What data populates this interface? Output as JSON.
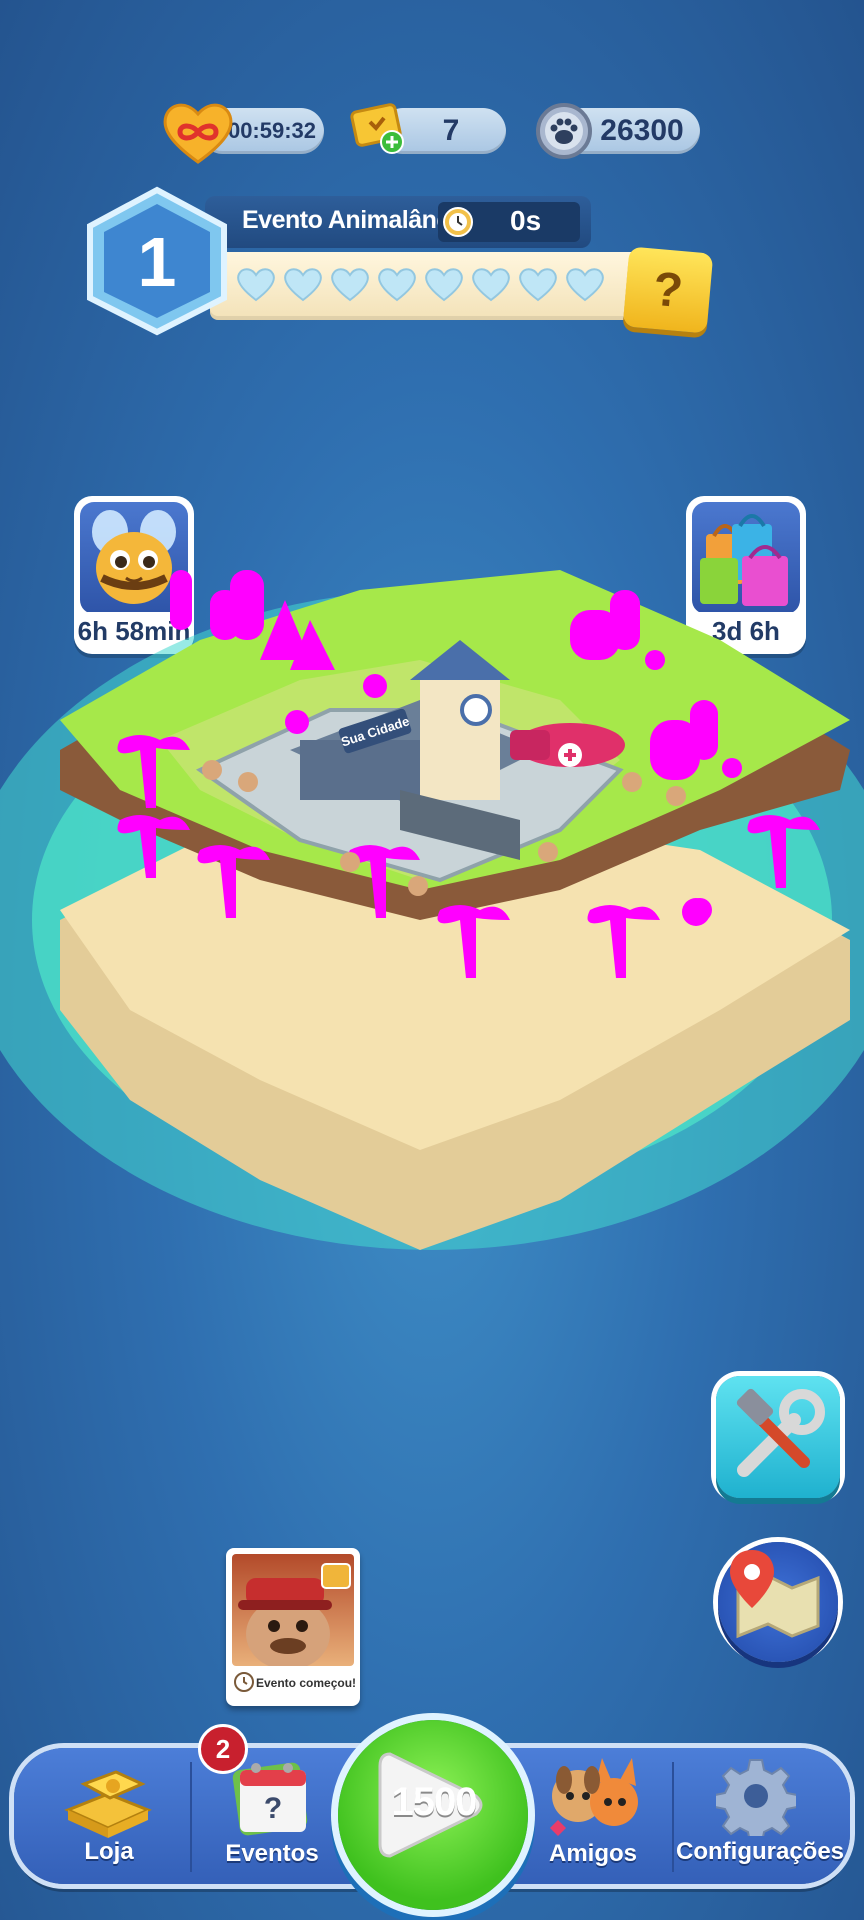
{
  "topbar": {
    "lives_timer": "00:59:32",
    "tickets": "7",
    "paws": "26300"
  },
  "event": {
    "level": "1",
    "title": "Evento Animalândia",
    "timer": "0s",
    "hearts_total": 8,
    "mystery": "?"
  },
  "side_events": {
    "left_timer": "6h 58min",
    "right_timer": "3d 6h"
  },
  "island": {
    "station_sign": "Sua Cidade"
  },
  "event_card": {
    "caption": "Evento começou!"
  },
  "nav": {
    "shop": "Loja",
    "events": "Eventos",
    "events_badge": "2",
    "play": "1500",
    "friends": "Amigos",
    "settings": "Configurações"
  },
  "colors": {
    "water": "#3ee0c8",
    "grass": "#a6e84a",
    "sand": "#f5e2b0",
    "magenta_trees": "#ff00ff",
    "play_green": "#4fcb25"
  },
  "icons": [
    "infinity-heart-icon",
    "ticket-plus-icon",
    "paw-coin-icon",
    "clock-icon",
    "bee-icon",
    "shopping-bags-icon",
    "tools-icon",
    "map-pin-icon",
    "gold-bars-icon",
    "calendar-icon",
    "pets-icon",
    "gear-icon"
  ]
}
